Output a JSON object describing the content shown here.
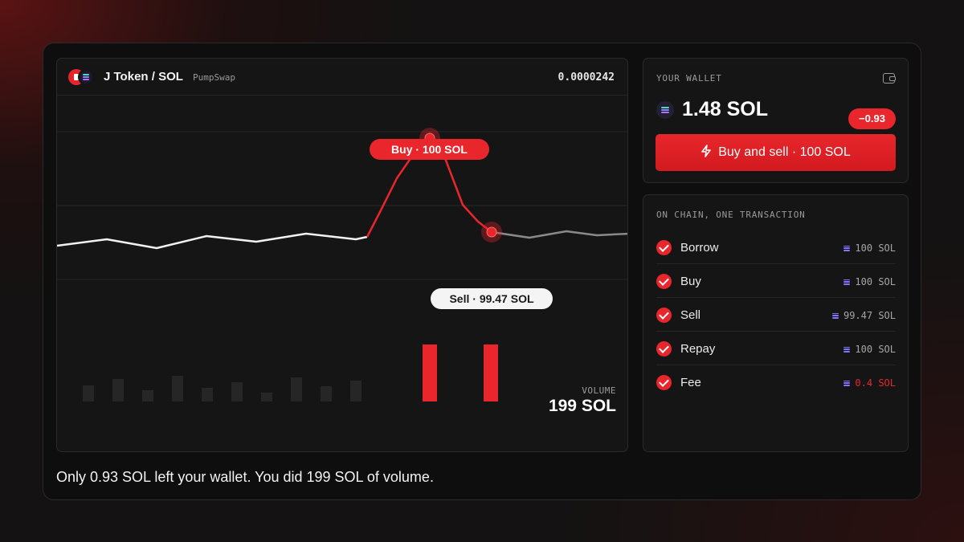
{
  "chart": {
    "pair": "J Token / SOL",
    "dex": "PumpSwap",
    "price": "0.0000242",
    "buy_tag": "Buy · 100 SOL",
    "sell_tag": "Sell · 99.47 SOL",
    "volume_label": "VOLUME",
    "volume_value": "199 SOL"
  },
  "wallet": {
    "label": "YOUR WALLET",
    "balance": "1.48 SOL",
    "delta": "−0.93",
    "cta": "Buy and sell · 100 SOL"
  },
  "steps": {
    "label": "ON CHAIN, ONE TRANSACTION",
    "items": [
      {
        "name": "Borrow",
        "amount": "100 SOL"
      },
      {
        "name": "Buy",
        "amount": "100 SOL"
      },
      {
        "name": "Sell",
        "amount": "99.47 SOL"
      },
      {
        "name": "Repay",
        "amount": "100 SOL"
      },
      {
        "name": "Fee",
        "amount": "0.4 SOL",
        "highlight": true
      }
    ]
  },
  "footer": "Only 0.93 SOL left your wallet. You did 199 SOL of volume.",
  "colors": {
    "accent": "#e8262c",
    "panel": "#151515",
    "background": "#0e0e0e",
    "muted": "#9a9a9a"
  }
}
